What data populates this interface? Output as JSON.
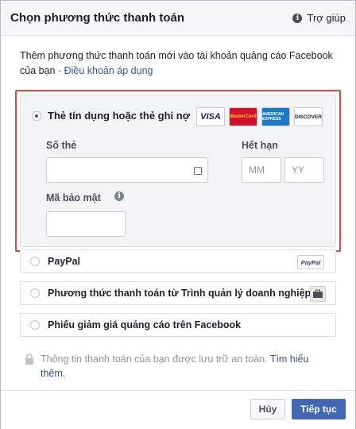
{
  "header": {
    "title": "Chọn phương thức thanh toán",
    "help_label": "Trợ giúp"
  },
  "intro": {
    "text": "Thêm phương thức thanh toán mới vào tài khoản quảng cáo Facebook của bạn · ",
    "link": "Điều khoản áp dụng"
  },
  "card_option": {
    "label": "Thẻ tín dụng hoặc thẻ ghi nợ",
    "selected": true,
    "logos": [
      "VISA",
      "MasterCard",
      "AMERICAN EXPRESS",
      "DISCOVER"
    ],
    "card_number_label": "Số thẻ",
    "card_number_value": "",
    "expiry_label": "Hết hạn",
    "month_placeholder": "MM",
    "year_placeholder": "YY",
    "security_label": "Mã bảo mật",
    "security_value": ""
  },
  "other_options": [
    {
      "label": "PayPal",
      "logo": "PayPal"
    },
    {
      "label": "Phương thức thanh toán từ Trình quản lý doanh nghiệp",
      "icon": "briefcase-icon"
    },
    {
      "label": "Phiếu giảm giá quảng cáo trên Facebook"
    }
  ],
  "secure_note": {
    "text": "Thông tin thanh toán của bạn được lưu trữ an toàn. ",
    "link": "Tìm hiểu thêm."
  },
  "footer": {
    "cancel_label": "Hủy",
    "next_label": "Tiếp tục"
  },
  "colors": {
    "accent": "#4267b2",
    "link": "#365899",
    "highlight_border": "#e0473e"
  }
}
